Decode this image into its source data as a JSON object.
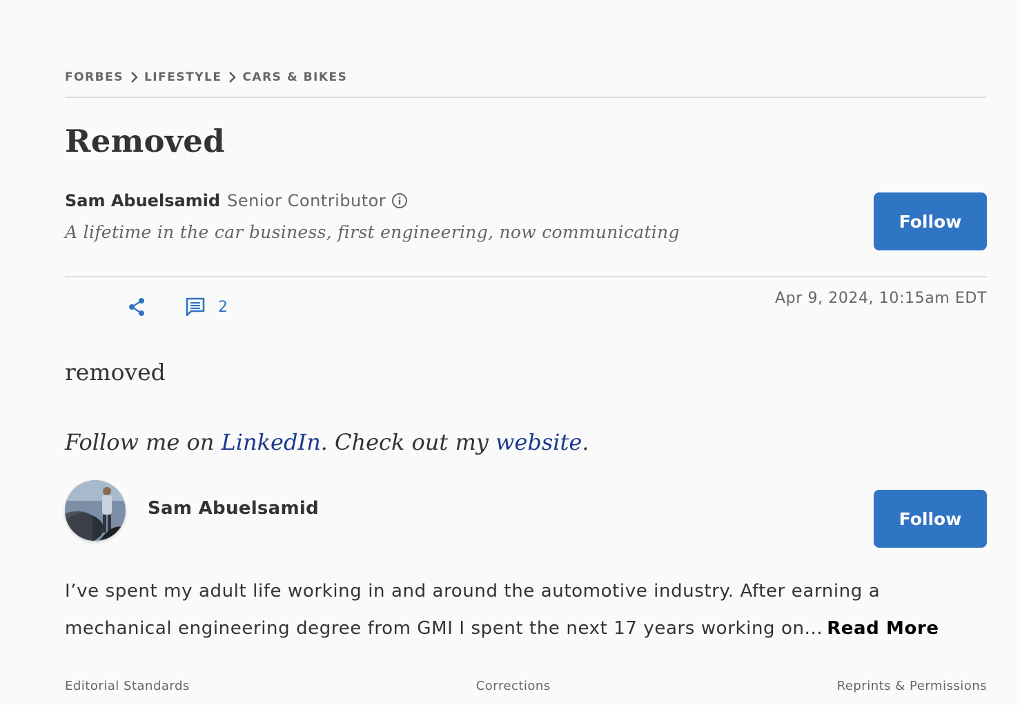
{
  "breadcrumb": {
    "items": [
      {
        "label": "FORBES"
      },
      {
        "label": "LIFESTYLE"
      },
      {
        "label": "CARS & BIKES"
      }
    ]
  },
  "article": {
    "headline": "Removed",
    "author_name": "Sam Abuelsamid",
    "author_role": "Senior Contributor",
    "tagline": "A lifetime in the car business, first engineering, now communicating",
    "follow_label": "Follow",
    "comment_count": "2",
    "timestamp": "Apr 9, 2024, 10:15am EDT",
    "body": "removed",
    "follow_line": {
      "prefix": "Follow me on ",
      "linkedin": "LinkedIn",
      "middle": ". Check out my ",
      "website": "website",
      "suffix": "."
    }
  },
  "author_bio": {
    "name": "Sam Abuelsamid",
    "follow_label": "Follow",
    "text": "I’ve spent my adult life working in and around the automotive industry. After earning a mechanical engineering degree from GMI I spent the next 17 years working on...",
    "read_more": "Read More"
  },
  "footer": {
    "links": [
      "Editorial Standards",
      "Corrections",
      "Reprints & Permissions"
    ]
  },
  "colors": {
    "accent": "#3074c4",
    "link": "#1a3a8c",
    "text": "#333333",
    "muted": "#666666",
    "background": "#fafafa"
  }
}
